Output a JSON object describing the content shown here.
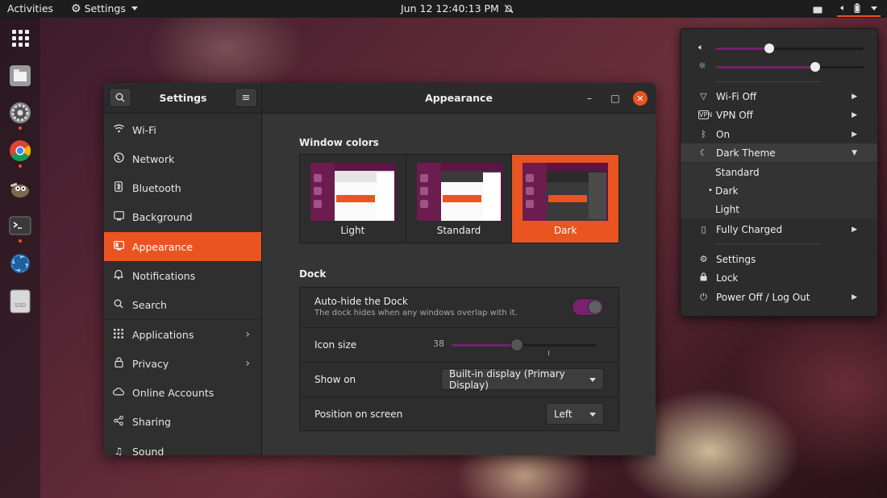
{
  "topbar": {
    "activities": "Activities",
    "app_menu": "Settings",
    "clock": "Jun 12  12:40:13 PM"
  },
  "dock": {
    "apps": [
      {
        "name": "show-applications"
      },
      {
        "name": "files"
      },
      {
        "name": "settings"
      },
      {
        "name": "chrome"
      },
      {
        "name": "gimp"
      },
      {
        "name": "terminal"
      },
      {
        "name": "steam"
      },
      {
        "name": "ssd-drive",
        "label": "SSD"
      }
    ]
  },
  "window": {
    "sidebar_title": "Settings",
    "title": "Appearance",
    "sidebar": {
      "items": [
        {
          "label": "Wi-Fi",
          "icon": "wifi-icon"
        },
        {
          "label": "Network",
          "icon": "network-icon"
        },
        {
          "label": "Bluetooth",
          "icon": "bluetooth-icon"
        },
        {
          "label": "Background",
          "icon": "background-icon"
        },
        {
          "label": "Appearance",
          "icon": "appearance-icon",
          "active": true
        },
        {
          "label": "Notifications",
          "icon": "bell-icon"
        },
        {
          "label": "Search",
          "icon": "search-icon"
        },
        {
          "label": "Applications",
          "icon": "grid-icon",
          "chevron": true
        },
        {
          "label": "Privacy",
          "icon": "lock-icon",
          "chevron": true
        },
        {
          "label": "Online Accounts",
          "icon": "cloud-icon"
        },
        {
          "label": "Sharing",
          "icon": "share-icon"
        },
        {
          "label": "Sound",
          "icon": "music-note-icon"
        }
      ]
    },
    "appearance": {
      "window_colors_title": "Window colors",
      "themes": [
        {
          "label": "Light",
          "selected": false
        },
        {
          "label": "Standard",
          "selected": false
        },
        {
          "label": "Dark",
          "selected": true
        }
      ],
      "dock_title": "Dock",
      "autohide_label": "Auto-hide the Dock",
      "autohide_sub": "The dock hides when any windows overlap with it.",
      "autohide_on": true,
      "icon_size_label": "Icon size",
      "icon_size_value": "38",
      "show_on_label": "Show on",
      "show_on_value": "Built-in display (Primary Display)",
      "position_label": "Position on screen",
      "position_value": "Left"
    }
  },
  "system_menu": {
    "volume_level": 0.36,
    "brightness_level": 0.67,
    "items": [
      {
        "label": "Wi-Fi Off",
        "icon": "wifi-off-icon"
      },
      {
        "label": "VPN Off",
        "icon": "vpn-icon"
      },
      {
        "label": "On",
        "icon": "bluetooth-icon"
      },
      {
        "label": "Dark Theme",
        "icon": "night-icon"
      }
    ],
    "theme_options": [
      "Standard",
      "Dark",
      "Light"
    ],
    "theme_selected": "Dark",
    "battery_label": "Fully Charged",
    "settings_label": "Settings",
    "lock_label": "Lock",
    "power_label": "Power Off / Log Out"
  },
  "colors": {
    "accent": "#e95420",
    "purple": "#77216f"
  }
}
